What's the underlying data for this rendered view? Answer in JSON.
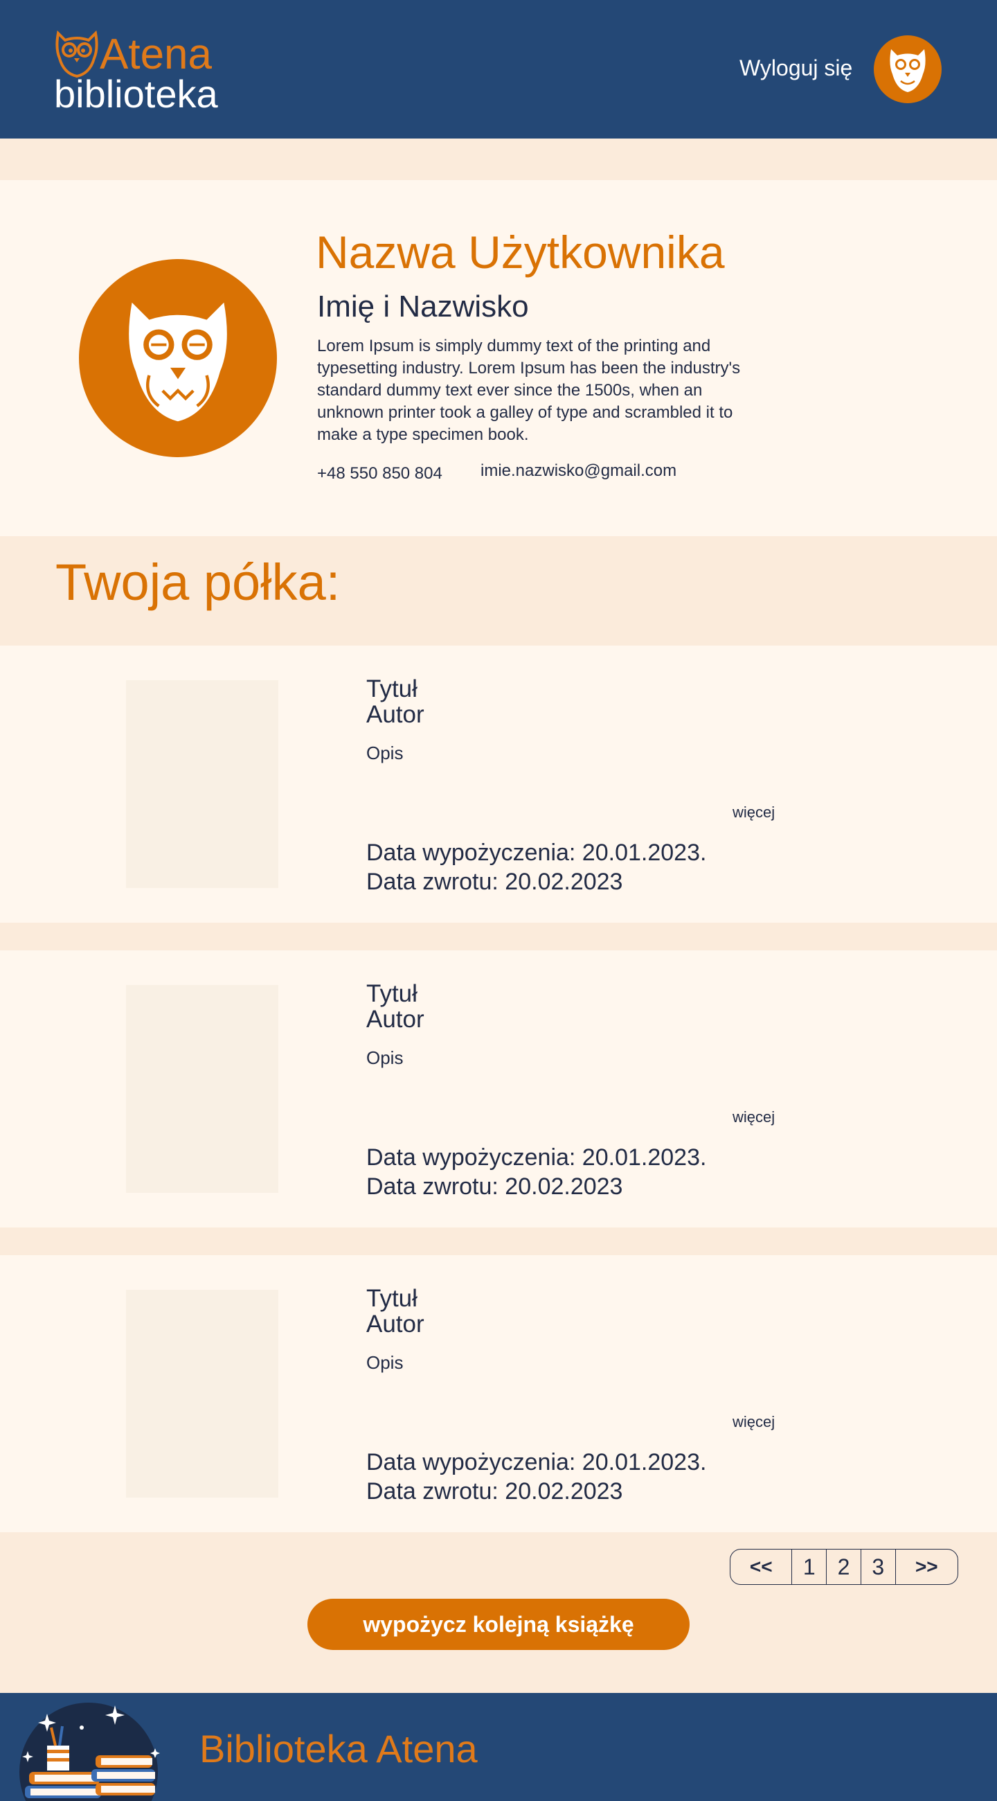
{
  "header": {
    "logo_top": "Atena",
    "logo_bottom": "biblioteka",
    "logout_label": "Wyloguj się"
  },
  "profile": {
    "username": "Nazwa Użytkownika",
    "full_name": "Imię i Nazwisko",
    "bio": "Lorem Ipsum is simply dummy text of the printing and typesetting industry. Lorem Ipsum has been the industry's standard dummy text ever since the 1500s, when an unknown printer took a galley of type and scrambled it to make a type specimen book.",
    "phone": "+48 550 850 804",
    "email": "imie.nazwisko@gmail.com"
  },
  "shelf": {
    "title": "Twoja półka:",
    "books": [
      {
        "title": "Tytuł",
        "author": "Autor",
        "description": "Opis",
        "more_label": "więcej",
        "loan_date": "Data wypożyczenia:  20.01.2023.",
        "return_date": "Data zwrotu: 20.02.2023"
      },
      {
        "title": "Tytuł",
        "author": "Autor",
        "description": "Opis",
        "more_label": "więcej",
        "loan_date": "Data wypożyczenia:  20.01.2023.",
        "return_date": "Data zwrotu: 20.02.2023"
      },
      {
        "title": "Tytuł",
        "author": "Autor",
        "description": "Opis",
        "more_label": "więcej",
        "loan_date": "Data wypożyczenia:  20.01.2023.",
        "return_date": "Data zwrotu: 20.02.2023"
      }
    ]
  },
  "pagination": {
    "prev": "<<",
    "pages": [
      "1",
      "2",
      "3"
    ],
    "next": ">>"
  },
  "cta_label": "wypożycz kolejną książkę",
  "footer": {
    "title": "Biblioteka Atena"
  },
  "colors": {
    "navy": "#244876",
    "orange": "#d97204",
    "cream": "#fff7ee",
    "peach": "#fbebdb"
  },
  "icons": [
    "owl-logo-icon",
    "owl-avatar-icon",
    "books-illustration"
  ]
}
